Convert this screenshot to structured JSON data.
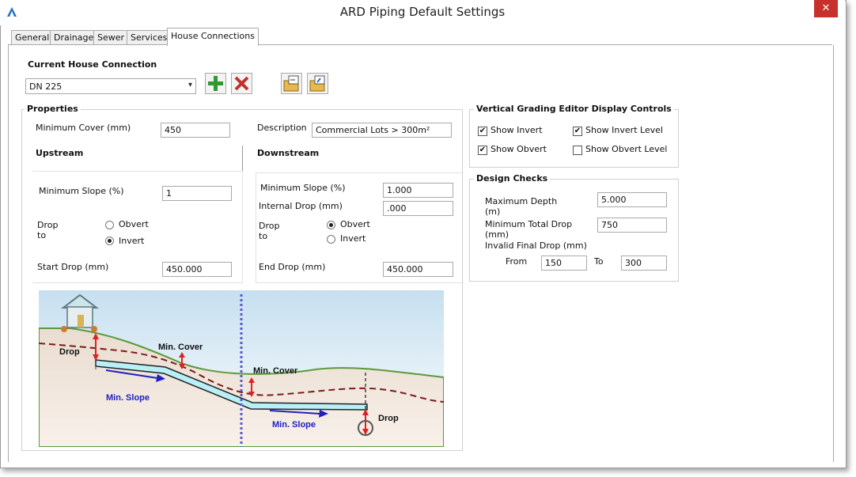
{
  "window": {
    "title": "ARD Piping Default Settings",
    "close_glyph": "✕"
  },
  "tabs": [
    {
      "label": "General"
    },
    {
      "label": "Drainage"
    },
    {
      "label": "Sewer"
    },
    {
      "label": "Services"
    },
    {
      "label": "House Connections"
    }
  ],
  "current": {
    "heading": "Current House Connection",
    "selected": "DN 225",
    "add_icon": "plus-icon",
    "delete_icon": "delete-icon"
  },
  "properties": {
    "heading": "Properties",
    "min_cover_label": "Minimum Cover (mm)",
    "min_cover_value": "450",
    "description_label": "Description",
    "description_value": "Commercial Lots > 300m²"
  },
  "upstream": {
    "heading": "Upstream",
    "min_slope_label": "Minimum Slope (%)",
    "min_slope_value": "1",
    "drop_label_1": "Drop",
    "drop_label_2": "to",
    "obvert_label": "Obvert",
    "invert_label": "Invert",
    "selected": "Invert",
    "start_drop_label": "Start Drop (mm)",
    "start_drop_value": "450.000"
  },
  "downstream": {
    "heading": "Downstream",
    "min_slope_label": "Minimum Slope (%)",
    "min_slope_value": "1.000",
    "internal_drop_label": "Internal Drop (mm)",
    "internal_drop_value": ".000",
    "drop_label_1": "Drop",
    "drop_label_2": "to",
    "obvert_label": "Obvert",
    "invert_label": "Invert",
    "selected": "Obvert",
    "end_drop_label": "End Drop (mm)",
    "end_drop_value": "450.000"
  },
  "vge": {
    "heading": "Vertical Grading Editor Display Controls",
    "show_invert": {
      "label": "Show Invert",
      "checked": true
    },
    "show_invert_level": {
      "label": "Show Invert Level",
      "checked": true
    },
    "show_obvert": {
      "label": "Show Obvert",
      "checked": true
    },
    "show_obvert_level": {
      "label": "Show Obvert Level",
      "checked": false
    }
  },
  "design": {
    "heading": "Design Checks",
    "max_depth_label_1": "Maximum Depth",
    "max_depth_label_2": "(m)",
    "max_depth_value": "5.000",
    "min_total_drop_label_1": "Minimum Total Drop",
    "min_total_drop_label_2": "(mm)",
    "min_total_drop_value": "750",
    "invalid_final_drop_label": "Invalid Final Drop (mm)",
    "from_label": "From",
    "from_value": "150",
    "to_label": "To",
    "to_value": "300"
  },
  "diagram": {
    "drop_left": "Drop",
    "min_cover_1": "Min. Cover",
    "min_cover_2": "Min. Cover",
    "min_slope_1": "Min. Slope",
    "min_slope_2": "Min. Slope",
    "drop_right": "Drop"
  }
}
